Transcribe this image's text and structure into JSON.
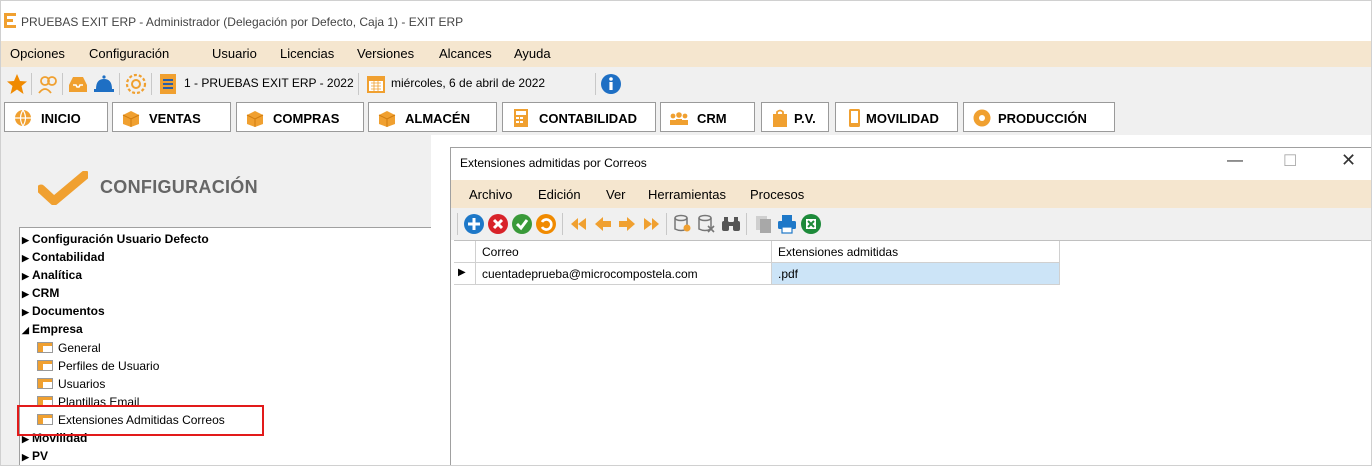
{
  "window": {
    "title": "PRUEBAS EXIT ERP - Administrador (Delegación por Defecto, Caja 1) - EXIT ERP"
  },
  "menu": [
    "Opciones",
    "Configuración",
    "Usuario",
    "Licencias",
    "Versiones",
    "Alcances",
    "Ayuda"
  ],
  "toolbar": {
    "company": "1 - PRUEBAS EXIT ERP - 2022",
    "date": "miércoles, 6 de abril de 2022",
    "icons": [
      "star-icon",
      "people-icon",
      "inbox-icon",
      "service-bell-icon",
      "gear-icon",
      "document-icon",
      "calendar-icon",
      "info-icon"
    ]
  },
  "modules": [
    "INICIO",
    "VENTAS",
    "COMPRAS",
    "ALMACÉN",
    "CONTABILIDAD",
    "CRM",
    "P.V.",
    "MOVILIDAD",
    "PRODUCCIÓN"
  ],
  "left": {
    "header": "CONFIGURACIÓN",
    "tree_top": [
      "Configuración Usuario Defecto",
      "Contabilidad",
      "Analítica",
      "CRM",
      "Documentos"
    ],
    "expanded": "Empresa",
    "children": [
      "General",
      "Perfiles de Usuario",
      "Usuarios",
      "Plantillas Email",
      "Extensiones Admitidas Correos"
    ],
    "tree_bottom": [
      "Movilidad",
      "PV"
    ]
  },
  "dialog": {
    "title": "Extensiones admitidas por Correos",
    "menu": [
      "Archivo",
      "Edición",
      "Ver",
      "Herramientas",
      "Procesos"
    ],
    "columns": [
      "Correo",
      "Extensiones admitidas"
    ],
    "rows": [
      {
        "correo": "cuentadeprueba@microcompostela.com",
        "extensiones": ".pdf"
      }
    ]
  },
  "colors": {
    "menu_bg": "#f5e6cf",
    "accent_orange": "#f0a030",
    "highlight_red": "#e21a1a",
    "selection_blue": "#cce4f7"
  }
}
